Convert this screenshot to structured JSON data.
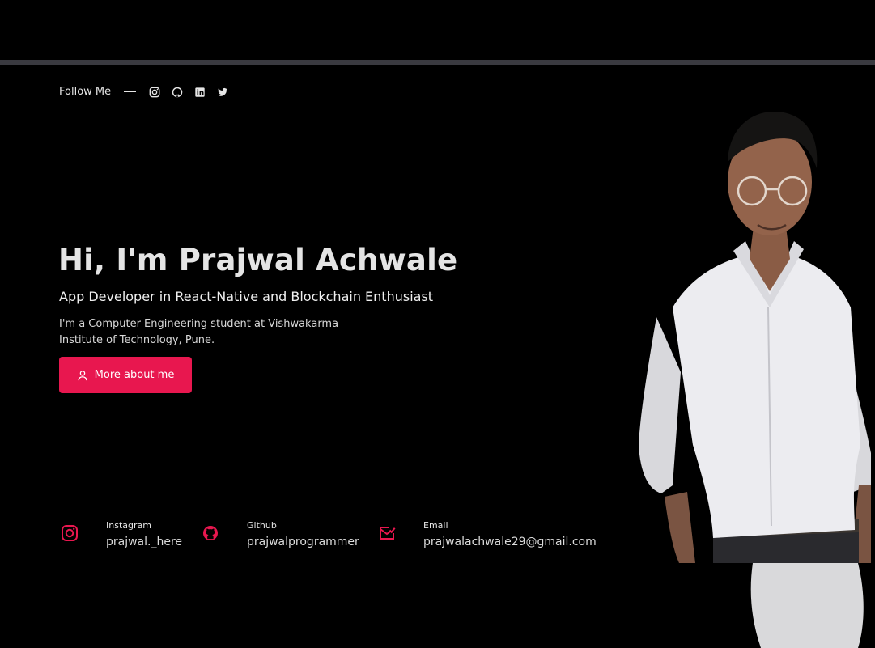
{
  "follow": {
    "label": "Follow Me",
    "icons": [
      "instagram-icon",
      "github-icon",
      "linkedin-icon",
      "twitter-icon"
    ]
  },
  "hero": {
    "title": "Hi, I'm Prajwal Achwale",
    "subtitle": "App Developer in React-Native and Blockchain Enthusiast",
    "description": "I'm a Computer Engineering student at Vishwakarma Institute of Technology, Pune.",
    "cta_label": "More about me"
  },
  "contacts": [
    {
      "icon": "instagram-icon",
      "label": "Instagram",
      "value": "prajwal._here"
    },
    {
      "icon": "github-icon",
      "label": "Github",
      "value": "prajwalprogrammer"
    },
    {
      "icon": "email-icon",
      "label": "Email",
      "value": "prajwalachwale29@gmail.com"
    }
  ],
  "colors": {
    "background": "#000000",
    "accent": "#e8174f",
    "text": "#e4e4e4",
    "top_bar": "#3a3a40"
  }
}
